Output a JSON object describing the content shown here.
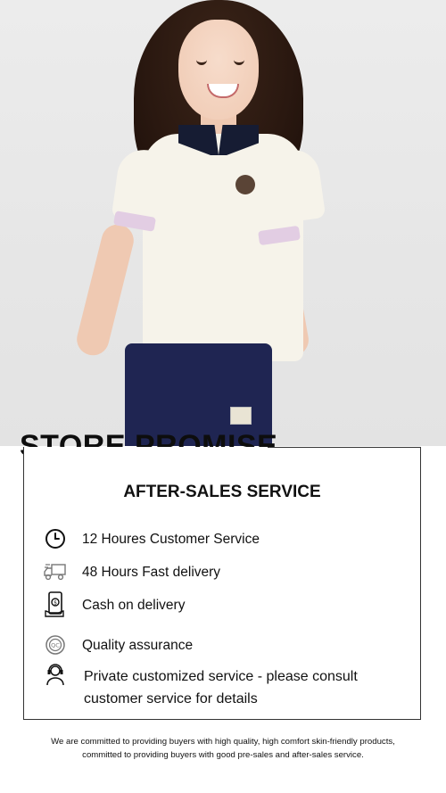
{
  "hero": {
    "image_alt": "Girl wearing white polo shirt with navy collar and navy shorts"
  },
  "store_promise": {
    "title": "STORE PROMISE"
  },
  "service_card": {
    "title": "AFTER-SALES SERVICE",
    "items": [
      {
        "icon": "clock-icon",
        "label": "12 Houres Customer Service"
      },
      {
        "icon": "truck-icon",
        "label": "48 Hours Fast delivery"
      },
      {
        "icon": "phone-cash-icon",
        "label": "Cash on delivery"
      },
      {
        "icon": "quality-badge-icon",
        "label": "Quality assurance"
      },
      {
        "icon": "headset-agent-icon",
        "label": "Private customized service - please consult customer service for details"
      }
    ]
  },
  "footer": {
    "line1": "We are committed to providing buyers with high quality, high comfort skin-friendly products,",
    "line2": "committed to providing buyers with good pre-sales and after-sales service."
  }
}
